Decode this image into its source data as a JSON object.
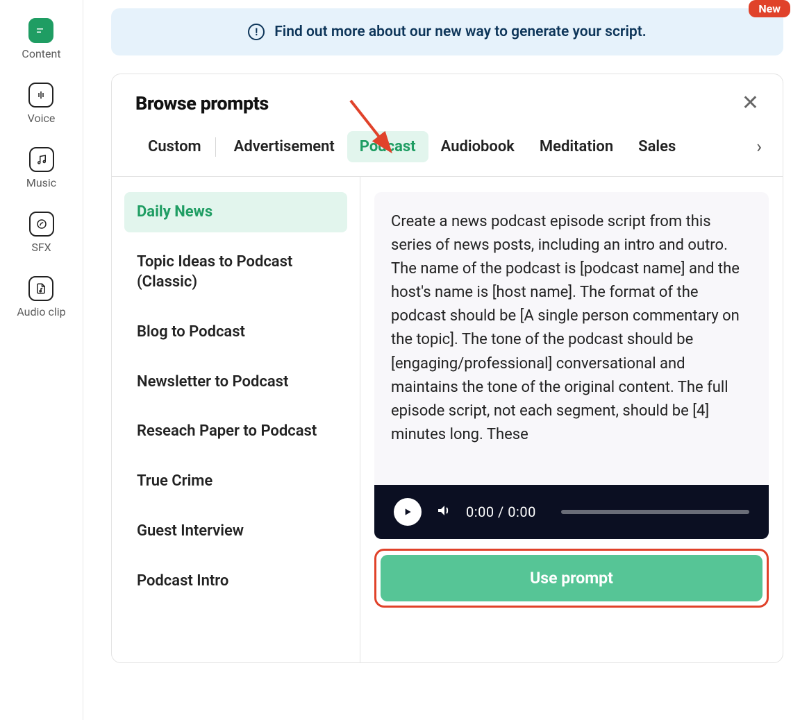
{
  "sidebar": {
    "items": [
      {
        "label": "Content",
        "icon": "content"
      },
      {
        "label": "Voice",
        "icon": "voice"
      },
      {
        "label": "Music",
        "icon": "music"
      },
      {
        "label": "SFX",
        "icon": "sfx"
      },
      {
        "label": "Audio clip",
        "icon": "audioclip"
      }
    ]
  },
  "banner": {
    "text": "Find out more about our new way to generate your script.",
    "badge": "New"
  },
  "modal": {
    "title": "Browse prompts",
    "tabs": [
      {
        "label": "Custom"
      },
      {
        "label": "Advertisement"
      },
      {
        "label": "Podcast",
        "active": true
      },
      {
        "label": "Audiobook"
      },
      {
        "label": "Meditation"
      },
      {
        "label": "Sales"
      }
    ],
    "prompts": [
      {
        "label": "Daily News",
        "active": true
      },
      {
        "label": "Topic Ideas to Podcast (Classic)"
      },
      {
        "label": "Blog to Podcast"
      },
      {
        "label": "Newsletter to Podcast"
      },
      {
        "label": "Reseach Paper to Podcast"
      },
      {
        "label": "True Crime"
      },
      {
        "label": "Guest Interview"
      },
      {
        "label": "Podcast Intro"
      }
    ],
    "detail_text": "Create a news podcast episode script from this series of news posts, including an intro and outro. The name of the podcast is [podcast name] and the host's name is [host name]. The format of the podcast should be [A single person commentary on the topic]. The tone of the podcast should be [engaging/professional] conversational and maintains the tone of the original content. The full episode script, not each segment, should be [4] minutes long. These",
    "audio": {
      "current": "0:00",
      "total": "0:00"
    },
    "use_button": "Use prompt"
  }
}
